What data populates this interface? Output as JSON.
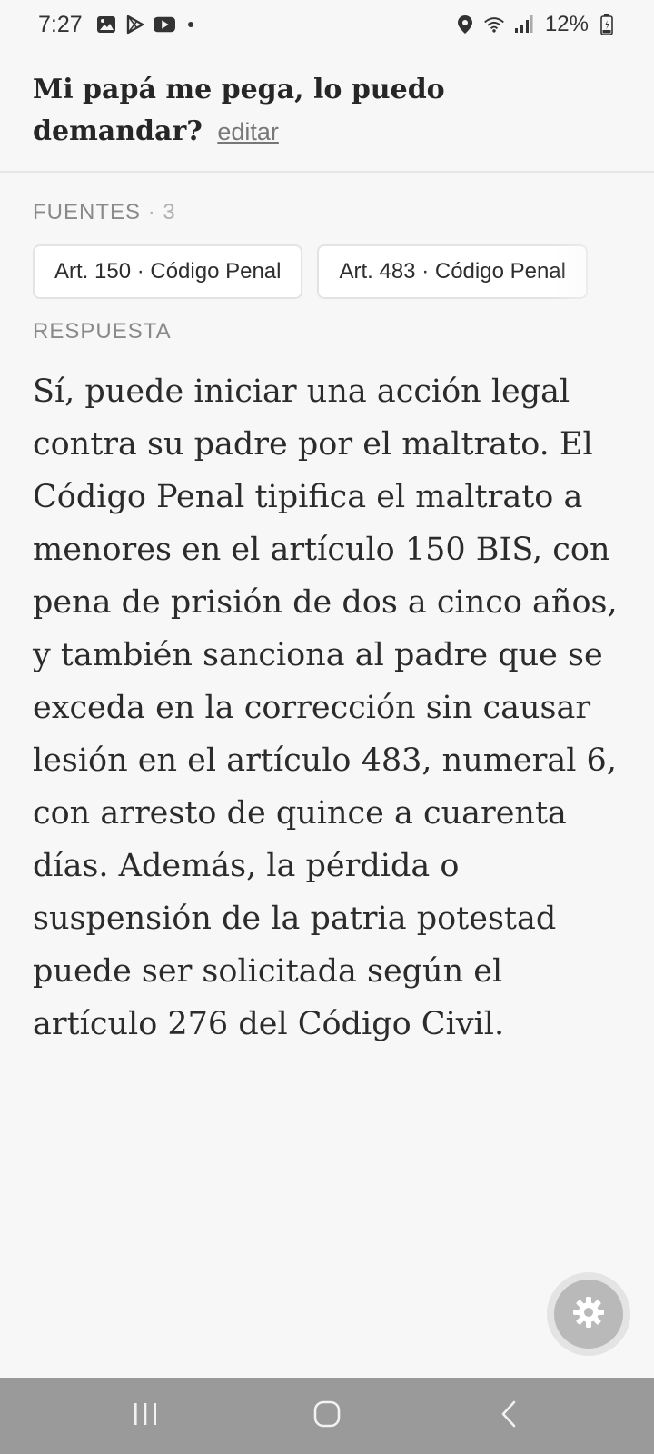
{
  "status_bar": {
    "time": "7:27",
    "battery": "12%",
    "left_icons": [
      "gallery-icon",
      "play-store-icon",
      "youtube-icon"
    ],
    "right_icons": [
      "location-icon",
      "wifi-icon",
      "signal-icon",
      "battery-icon"
    ]
  },
  "header": {
    "question": "Mi papá me pega, lo puedo demandar?",
    "edit_label": "editar"
  },
  "sources": {
    "label": "FUENTES",
    "count": "· 3",
    "items": [
      {
        "label": "Art. 150 · Código Penal"
      },
      {
        "label": "Art. 483 · Código Penal"
      }
    ]
  },
  "answer": {
    "label": "RESPUESTA",
    "text": "Sí, puede iniciar una acción legal contra su padre por el maltrato. El Código Penal tipifica el maltrato a menores en el artículo 150 BIS, con pena de prisión de dos a cinco años, y también sanciona al padre que se exceda en la corrección sin causar lesión en el artículo 483, numeral 6, con arresto de quince a cuarenta días. Además, la pérdida o suspensión de la patria potestad puede ser solicitada según el artículo 276 del Código Civil."
  },
  "fab": {
    "icon": "gear-icon"
  },
  "nav_bar": {
    "icons": [
      "recents-icon",
      "home-icon",
      "back-icon"
    ]
  },
  "colors": {
    "background": "#f7f7f7",
    "nav_bar": "#9a9a9a",
    "fab": "#b9b9b9",
    "label_gray": "#8a8a8a"
  }
}
